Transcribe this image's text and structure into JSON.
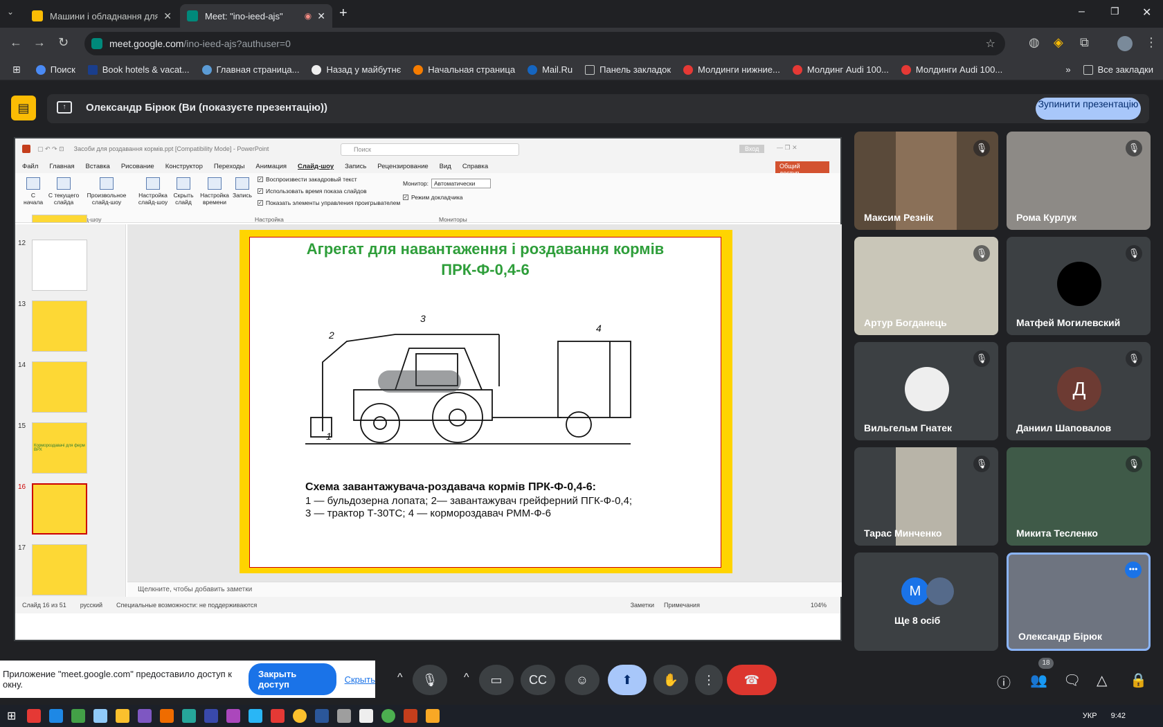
{
  "browser": {
    "tabs": [
      {
        "title": "Машини і обладнання для тва",
        "active": false
      },
      {
        "title": "Meet: \"ino-ieed-ajs\"",
        "active": true
      }
    ],
    "new_tab": "+",
    "url_host": "meet.google.com",
    "url_path": "/ino-ieed-ajs?authuser=0",
    "bookmarks": [
      "Поиск",
      "Book hotels & vacat...",
      "Главная страница...",
      "Назад у майбутнє",
      "Начальная страница",
      "Mail.Ru",
      "Панель закладок",
      "Молдинги нижние...",
      "Молдинг Audi 100...",
      "Молдинги Audi 100..."
    ],
    "all_bookmarks": "Все закладки"
  },
  "meet": {
    "presenter_label": "Олександр Бірюк (Ви (показуєте презентацію))",
    "stop_button": "Зупинити презентацію",
    "participants": [
      {
        "name": "Максим Резнік",
        "muted": true
      },
      {
        "name": "Рома Курлук",
        "muted": true
      },
      {
        "name": "Артур Богданець",
        "muted": true
      },
      {
        "name": "Матфей Могилевский",
        "muted": true
      },
      {
        "name": "Вильгельм Гнатек",
        "muted": true
      },
      {
        "name": "Даниил Шаповалов",
        "muted": true,
        "initial": "Д"
      },
      {
        "name": "Тарас Минченко",
        "muted": true
      },
      {
        "name": "Микита Тесленко",
        "muted": true
      },
      {
        "name": "Ще 8 осіб",
        "initial": "M"
      },
      {
        "name": "Олександр Бірюк",
        "speaking": true
      }
    ],
    "participant_count": "18",
    "share_banner": {
      "text": "Приложение \"meet.google.com\" предоставило доступ к окну.",
      "close_button": "Закрыть доступ",
      "hide_link": "Скрыть"
    }
  },
  "powerpoint": {
    "title": "Засоби для роздавання кормів.ppt [Compatibility Mode] - PowerPoint",
    "search_placeholder": "Поиск",
    "signin": "Вход",
    "menu_tabs": [
      "Файл",
      "Главная",
      "Вставка",
      "Рисование",
      "Конструктор",
      "Переходы",
      "Анимация",
      "Слайд-шоу",
      "Запись",
      "Рецензирование",
      "Вид",
      "Справка"
    ],
    "share": "Общий доступ",
    "ribbon": {
      "from_start": "С начала",
      "from_current": "С текущего слайда",
      "custom": "Произвольное слайд-шоу",
      "setup": "Настройка слайд-шоу",
      "hide": "Скрыть слайд",
      "timing": "Настройка времени",
      "record": "Запись",
      "group_start": "Начать слайд-шоу",
      "group_setup": "Настройка",
      "group_monitors": "Мониторы",
      "chk1": "Воспроизвести закадровый текст",
      "chk2": "Использовать время показа слайдов",
      "chk3": "Показать элементы управления проигрывателем",
      "monitor_label": "Монитор:",
      "monitor_value": "Автоматически",
      "presenter_mode": "Режим докладчика"
    },
    "thumbnails": [
      "12",
      "13",
      "14",
      "15",
      "16",
      "17"
    ],
    "thumb15_text": "Кормороздавачі для ферм ВРХ",
    "slide": {
      "title1": "Агрегат для навантаження і   роздавання кормів",
      "title2": "ПРК-Ф-0,4-6",
      "caption_title": "Схема завантажувача-роздавача кормів ПРК-Ф-0,4-6:",
      "caption_line1": "1 — бульдозерна лопата; 2— завантажувач грейферний ПГК-Ф-0,4;",
      "caption_line2": "3 — трактор Т-30ТС; 4 — кормороздавач РММ-Ф-6",
      "labels": [
        "1",
        "2",
        "3",
        "4"
      ]
    },
    "notes_placeholder": "Щелкните, чтобы добавить заметки",
    "status": {
      "slide": "Слайд 16 из 51",
      "lang": "русский",
      "accessibility": "Специальные возможности: не поддерживаются",
      "notes": "Заметки",
      "comments": "Примечания",
      "zoom": "104%"
    }
  },
  "taskbar": {
    "lang": "УКР",
    "time": "9:42"
  }
}
